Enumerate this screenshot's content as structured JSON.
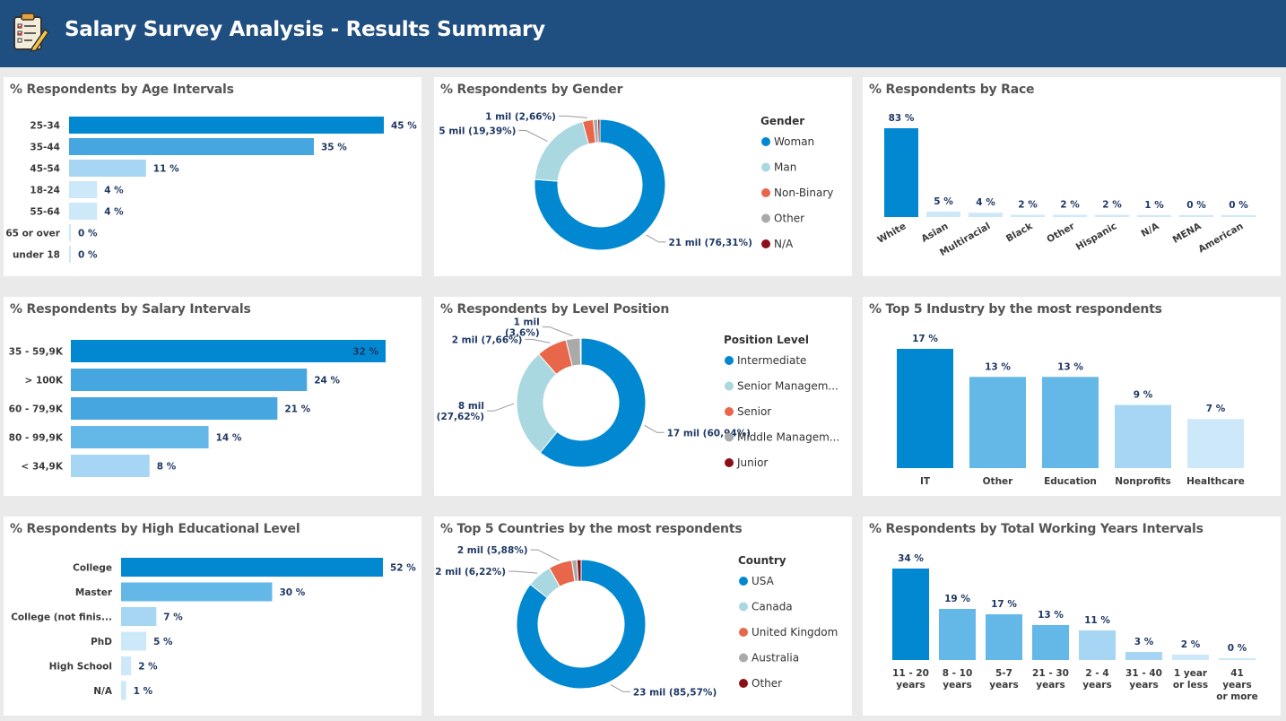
{
  "header": {
    "title": "Salary Survey Analysis - Results Summary",
    "logo_icon": "survey-clipboard-icon",
    "bg_color": "#1f4e80"
  },
  "colors": {
    "c1": "#0288d1",
    "c2": "#46a6df",
    "c3": "#64b8e8",
    "c4": "#a6d6f3",
    "c5": "#cde8f9",
    "pie": [
      "#0288d1",
      "#a9d8e0",
      "#e8674a",
      "#aaaaaa",
      "#8b0f19"
    ]
  },
  "chart_data": [
    {
      "id": "age",
      "type": "bar",
      "orientation": "horizontal",
      "title": "% Respondents by Age Intervals",
      "categories": [
        "25-34",
        "35-44",
        "45-54",
        "18-24",
        "55-64",
        "65 or over",
        "under 18"
      ],
      "values": [
        45,
        35,
        11,
        4,
        4,
        0,
        0
      ],
      "labels": [
        "45 %",
        "35 %",
        "11 %",
        "4 %",
        "4 %",
        "0 %",
        "0 %"
      ],
      "xlim": [
        0,
        45
      ]
    },
    {
      "id": "gender",
      "type": "pie",
      "donut": true,
      "title": "% Respondents by Gender",
      "legend_title": "Gender",
      "legend_position": "right",
      "categories": [
        "Woman",
        "Man",
        "Non-Binary",
        "Other",
        "N/A"
      ],
      "values": [
        76.31,
        19.39,
        2.66,
        1.1,
        0.54
      ],
      "labels": [
        "21 mil (76,31%)",
        "5 mil (19,39%)",
        "1 mil (2,66%)",
        "",
        ""
      ]
    },
    {
      "id": "race",
      "type": "bar",
      "orientation": "vertical",
      "title": "% Respondents by Race",
      "categories": [
        "White",
        "Asian",
        "Multiracial",
        "Black",
        "Other",
        "Hispanic",
        "N/A",
        "MENA",
        "American"
      ],
      "values": [
        83,
        5,
        4,
        2,
        2,
        2,
        1,
        0,
        0
      ],
      "labels": [
        "83 %",
        "5 %",
        "4 %",
        "2 %",
        "2 %",
        "2 %",
        "1 %",
        "0 %",
        "0 %"
      ],
      "ylim": [
        0,
        83
      ]
    },
    {
      "id": "salary",
      "type": "bar",
      "orientation": "horizontal",
      "title": "% Respondents by Salary Intervals",
      "categories": [
        "35 - 59,9K",
        "> 100K",
        "60 - 79,9K",
        "80 - 99,9K",
        "< 34,9K"
      ],
      "values": [
        32,
        24,
        21,
        14,
        8
      ],
      "labels": [
        "32 %",
        "24 %",
        "21 %",
        "14 %",
        "8 %"
      ],
      "xlim": [
        0,
        32
      ]
    },
    {
      "id": "level",
      "type": "pie",
      "donut": true,
      "title": "% Respondents by Level Position",
      "legend_title": "Position Level",
      "legend_position": "right",
      "categories": [
        "Intermediate",
        "Senior Managem...",
        "Senior",
        "Middle Managem...",
        "Junior"
      ],
      "values": [
        60.94,
        27.62,
        7.66,
        3.6,
        0.18
      ],
      "labels": [
        "17 mil (60,94%)",
        "8 mil (27,62%)",
        "2 mil (7,66%)",
        "1 mil (3,6%)",
        ""
      ]
    },
    {
      "id": "industry",
      "type": "bar",
      "orientation": "vertical",
      "title": "% Top 5 Industry by the most respondents",
      "categories": [
        "IT",
        "Other",
        "Education",
        "Nonprofits",
        "Healthcare"
      ],
      "values": [
        17,
        13,
        13,
        9,
        7
      ],
      "labels": [
        "17 %",
        "13 %",
        "13 %",
        "9 %",
        "7 %"
      ],
      "ylim": [
        0,
        17
      ]
    },
    {
      "id": "education",
      "type": "bar",
      "orientation": "horizontal",
      "title": "% Respondents by High Educational Level",
      "categories": [
        "College",
        "Master",
        "College (not finis...",
        "PhD",
        "High School",
        "N/A"
      ],
      "values": [
        52,
        30,
        7,
        5,
        2,
        1
      ],
      "labels": [
        "52 %",
        "30 %",
        "7 %",
        "5 %",
        "2 %",
        "1 %"
      ],
      "xlim": [
        0,
        52
      ]
    },
    {
      "id": "country",
      "type": "pie",
      "donut": true,
      "title": "% Top 5 Countries by the most respondents",
      "legend_title": "Country",
      "legend_position": "right",
      "categories": [
        "USA",
        "Canada",
        "United Kingdom",
        "Australia",
        "Other"
      ],
      "values": [
        85.57,
        6.22,
        5.88,
        1.3,
        1.03
      ],
      "labels": [
        "23 mil (85,57%)",
        "2 mil (6,22%)",
        "2 mil (5,88%)",
        "",
        ""
      ]
    },
    {
      "id": "years",
      "type": "bar",
      "orientation": "vertical",
      "title": "% Respondents by Total Working Years Intervals",
      "categories": [
        "11 - 20 years",
        "8 - 10 years",
        "5-7 years",
        "21 - 30 years",
        "2 - 4 years",
        "31 - 40 years",
        "1 year or less",
        "41 years or more"
      ],
      "values": [
        34,
        19,
        17,
        13,
        11,
        3,
        2,
        0
      ],
      "labels": [
        "34 %",
        "19 %",
        "17 %",
        "13 %",
        "11 %",
        "3 %",
        "2 %",
        "0 %"
      ],
      "ylim": [
        0,
        34
      ]
    }
  ]
}
